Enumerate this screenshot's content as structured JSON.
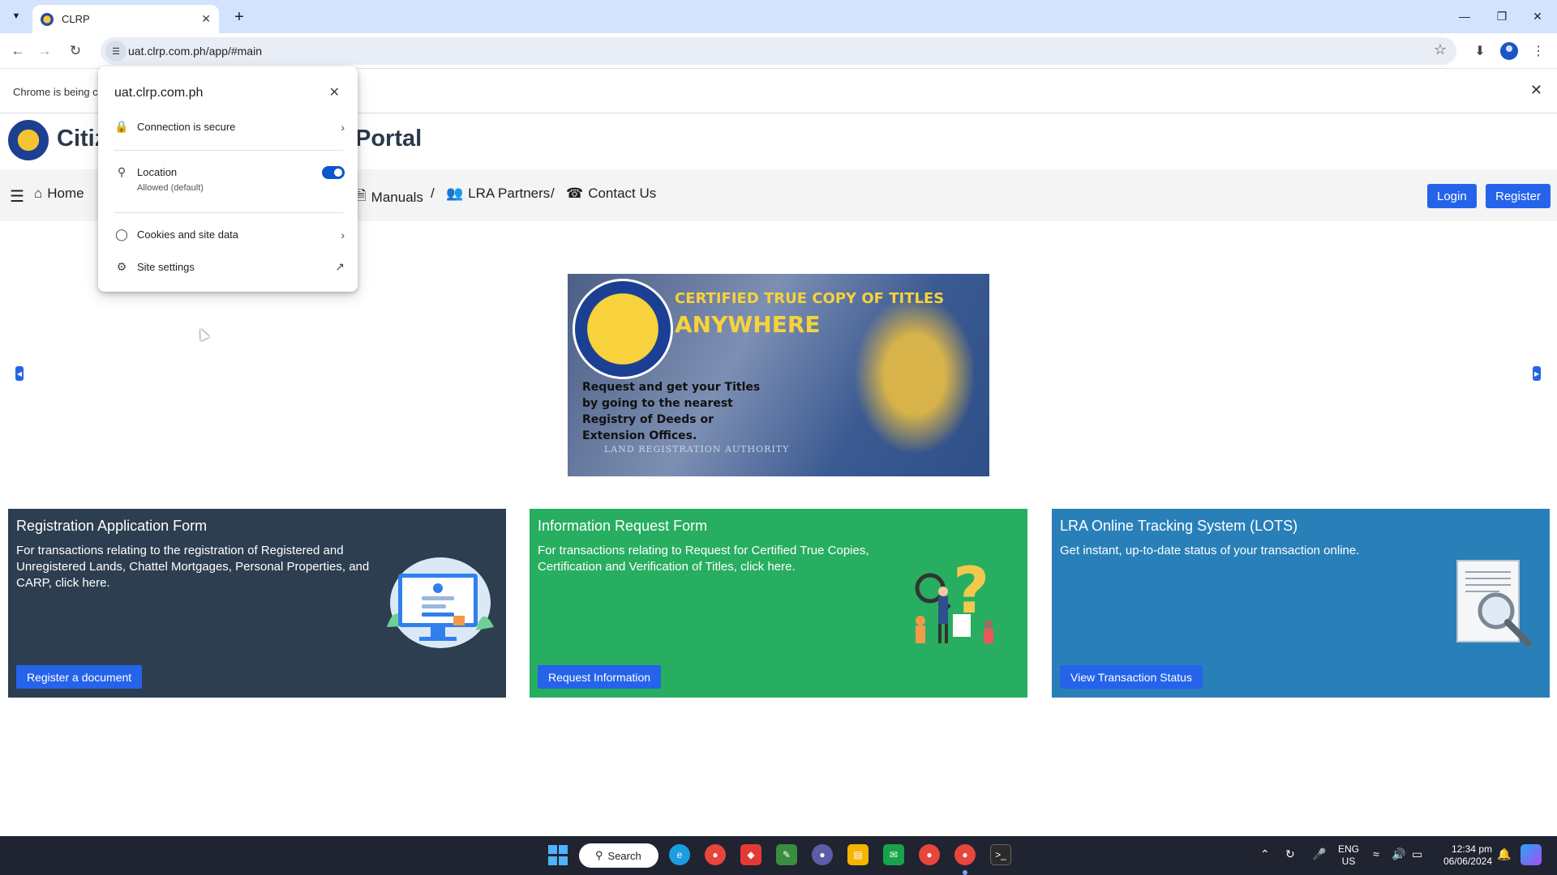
{
  "browser": {
    "tab_title": "CLRP",
    "url": "uat.clrp.com.ph/app/#main",
    "infobar_text": "Chrome is being c"
  },
  "site": {
    "title_left": "Citiz",
    "title_right": "Portal"
  },
  "nav": {
    "home": "Home",
    "manuals": "Manuals",
    "partners": "LRA Partners",
    "contact": "Contact Us",
    "sep": "/",
    "login": "Login",
    "register": "Register"
  },
  "banner": {
    "headline1": "CERTIFIED TRUE COPY OF TITLES",
    "headline2": "ANYWHERE",
    "body": "Request and get your Titles by going to the nearest Registry of Deeds or Extension Offices.",
    "seal_text": "LAND REGISTRATION AUTHORITY",
    "footer": "LAND REGISTRATION AUTHORITY"
  },
  "cards": [
    {
      "title": "Registration Application Form",
      "description": "For transactions relating to the registration of Registered and Unregistered Lands, Chattel Mortgages, Personal Properties, and CARP, click here.",
      "button": "Register a document",
      "color": "#2c3e50"
    },
    {
      "title": "Information Request Form",
      "description": "For transactions relating to Request for Certified True Copies, Certification and Verification of Titles, click here.",
      "button": "Request Information",
      "color": "#27ae60"
    },
    {
      "title": "LRA Online Tracking System (LOTS)",
      "description": "Get instant, up-to-date status of your transaction online.",
      "button": "View Transaction Status",
      "color": "#2980b9"
    }
  ],
  "popup": {
    "host": "uat.clrp.com.ph",
    "connection": "Connection is secure",
    "location": "Location",
    "location_sub": "Allowed (default)",
    "location_enabled": true,
    "cookies": "Cookies and site data",
    "site_settings": "Site settings"
  },
  "taskbar": {
    "search": "Search",
    "lang_top": "ENG",
    "lang_bottom": "US",
    "time": "12:34 pm",
    "date": "06/06/2024"
  },
  "colors": {
    "accent": "#2563eb",
    "tabstrip": "#d3e3fd",
    "taskbar": "#1f2430"
  }
}
